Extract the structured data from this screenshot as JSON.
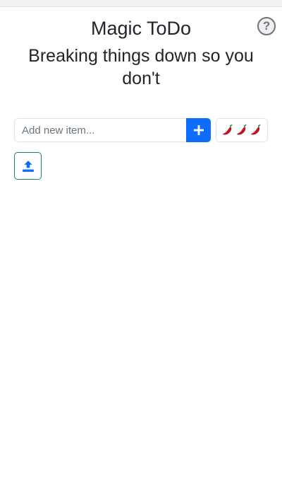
{
  "header": {
    "title": "Magic ToDo",
    "tagline": "Breaking things down so you don't",
    "help_label": "?"
  },
  "new_item": {
    "placeholder": "Add new item...",
    "value": ""
  },
  "controls": {
    "add_icon": "plus-icon",
    "spiciness_icons": [
      "chili-pepper-icon",
      "chili-pepper-icon",
      "chili-pepper-icon"
    ],
    "upload_icon": "upload-icon"
  },
  "colors": {
    "primary": "#0d6efd",
    "upload_border": "#198754",
    "upload_icon": "#0d6efd",
    "chili": "#c1121f"
  }
}
